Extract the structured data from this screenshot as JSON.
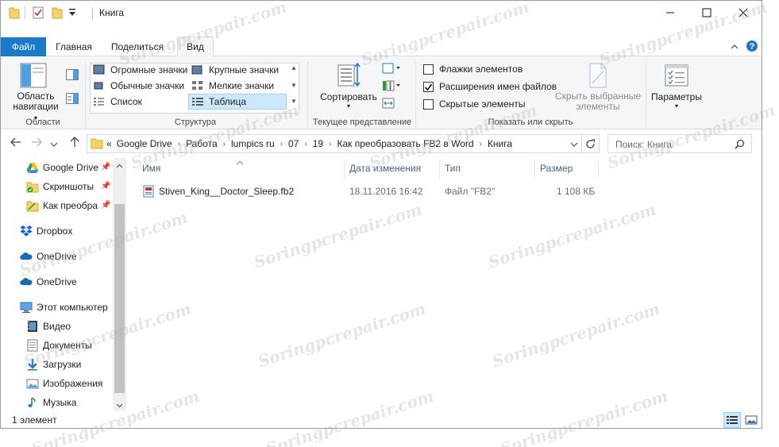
{
  "window": {
    "title": "Книга"
  },
  "ribbon": {
    "tabs": [
      "Файл",
      "Главная",
      "Поделиться",
      "Вид"
    ],
    "panes_group": {
      "nav_pane_label_line1": "Область",
      "nav_pane_label_line2": "навигации",
      "group_label": "Области"
    },
    "layout_group": {
      "items": [
        "Огромные значки",
        "Крупные значки",
        "Обычные значки",
        "Мелкие значки",
        "Список",
        "Таблица"
      ],
      "selected": "Таблица",
      "group_label": "Структура"
    },
    "current_view_group": {
      "sort_label": "Сортировать",
      "group_label": "Текущее представление"
    },
    "show_hide_group": {
      "item_checkboxes": "Флажки элементов",
      "file_extensions": "Расширения имен файлов",
      "hidden_items": "Скрытые элементы",
      "item_checkboxes_checked": false,
      "file_extensions_checked": true,
      "hidden_items_checked": false,
      "hide_selected_line1": "Скрыть выбранные",
      "hide_selected_line2": "элементы",
      "group_label": "Показать или скрыть"
    },
    "options_label": "Параметры"
  },
  "address": {
    "overflow": "«",
    "crumbs": [
      "Google Drive",
      "Работа",
      "lumpics ru",
      "07",
      "19",
      "Как преобразовать FB2 в Word",
      "Книга"
    ],
    "search_placeholder": "Поиск: Книга"
  },
  "nav": {
    "items": [
      {
        "label": "Google Drive",
        "icon": "google-drive-icon",
        "pinned": true
      },
      {
        "label": "Скриншоты",
        "icon": "folder-icon",
        "pinned": true
      },
      {
        "label": "Как преобра",
        "icon": "folder-icon",
        "pinned": true
      },
      {
        "label": "Dropbox",
        "icon": "dropbox-icon",
        "pinned": false
      },
      {
        "label": "OneDrive",
        "icon": "onedrive-icon",
        "pinned": false
      },
      {
        "label": "OneDrive",
        "icon": "onedrive-icon",
        "pinned": false
      },
      {
        "label": "Этот компьютер",
        "icon": "computer-icon",
        "pinned": false
      },
      {
        "label": "Видео",
        "icon": "video-folder-icon",
        "pinned": false
      },
      {
        "label": "Документы",
        "icon": "documents-folder-icon",
        "pinned": false
      },
      {
        "label": "Загрузки",
        "icon": "downloads-folder-icon",
        "pinned": false
      },
      {
        "label": "Изображения",
        "icon": "pictures-folder-icon",
        "pinned": false
      },
      {
        "label": "Музыка",
        "icon": "music-folder-icon",
        "pinned": false
      }
    ],
    "pin_glyph": "📌"
  },
  "filelist": {
    "columns": [
      "Имя",
      "Дата изменения",
      "Тип",
      "Размер"
    ],
    "rows": [
      {
        "name": "Stiven_King__Doctor_Sleep.fb2",
        "date": "18.11.2016 16:42",
        "type": "Файл \"FB2\"",
        "size": "1 108 КБ"
      }
    ]
  },
  "status": {
    "count": "1 элемент"
  },
  "watermark": "Soringpcrepair.com",
  "colors": {
    "accent": "#1979ca",
    "selection": "#cce8ff"
  }
}
